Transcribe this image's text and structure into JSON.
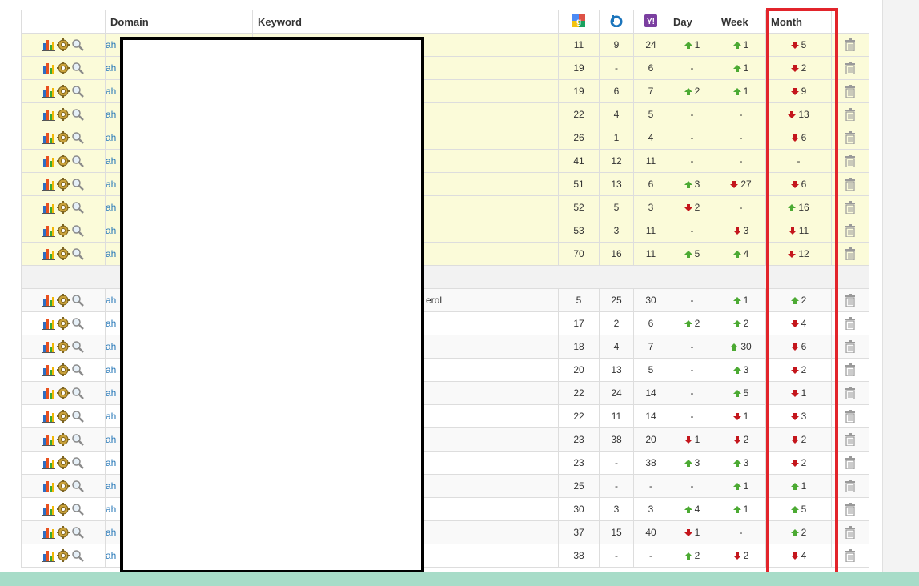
{
  "header": {
    "domain": "Domain",
    "keyword": "Keyword",
    "google_icon": "google-icon",
    "bing_icon": "bing-icon",
    "yahoo_icon": "yahoo-icon",
    "day": "Day",
    "week": "Week",
    "month": "Month"
  },
  "colors": {
    "highlight_row": "#fbfbd9",
    "up_arrow": "#4caa33",
    "down_arrow": "#c4161c",
    "link": "#2a7ab9",
    "annotation_box": "#e2242b",
    "bottom_bar": "#a7dcc8"
  },
  "icons": {
    "stats": "bar-chart-icon",
    "settings": "gear-icon",
    "search": "magnifier-icon",
    "delete": "trash-icon"
  },
  "group1": [
    {
      "domain": "ah",
      "keyword": "",
      "g": "11",
      "b": "9",
      "y": "24",
      "day": {
        "dir": "up",
        "v": "1"
      },
      "week": {
        "dir": "up",
        "v": "1"
      },
      "month": {
        "dir": "down",
        "v": "5"
      }
    },
    {
      "domain": "ah",
      "keyword": "",
      "g": "19",
      "b": "-",
      "y": "6",
      "day": {
        "dir": "none",
        "v": "-"
      },
      "week": {
        "dir": "up",
        "v": "1"
      },
      "month": {
        "dir": "down",
        "v": "2"
      }
    },
    {
      "domain": "ah",
      "keyword": "",
      "g": "19",
      "b": "6",
      "y": "7",
      "day": {
        "dir": "up",
        "v": "2"
      },
      "week": {
        "dir": "up",
        "v": "1"
      },
      "month": {
        "dir": "down",
        "v": "9"
      }
    },
    {
      "domain": "ah",
      "keyword": "",
      "g": "22",
      "b": "4",
      "y": "5",
      "day": {
        "dir": "none",
        "v": "-"
      },
      "week": {
        "dir": "none",
        "v": "-"
      },
      "month": {
        "dir": "down",
        "v": "13"
      }
    },
    {
      "domain": "ah",
      "keyword": "",
      "g": "26",
      "b": "1",
      "y": "4",
      "day": {
        "dir": "none",
        "v": "-"
      },
      "week": {
        "dir": "none",
        "v": "-"
      },
      "month": {
        "dir": "down",
        "v": "6"
      }
    },
    {
      "domain": "ah",
      "keyword": "",
      "g": "41",
      "b": "12",
      "y": "11",
      "day": {
        "dir": "none",
        "v": "-"
      },
      "week": {
        "dir": "none",
        "v": "-"
      },
      "month": {
        "dir": "none",
        "v": "-"
      }
    },
    {
      "domain": "ah",
      "keyword": "",
      "g": "51",
      "b": "13",
      "y": "6",
      "day": {
        "dir": "up",
        "v": "3"
      },
      "week": {
        "dir": "down",
        "v": "27"
      },
      "month": {
        "dir": "down",
        "v": "6"
      }
    },
    {
      "domain": "ah",
      "keyword": "",
      "g": "52",
      "b": "5",
      "y": "3",
      "day": {
        "dir": "down",
        "v": "2"
      },
      "week": {
        "dir": "none",
        "v": "-"
      },
      "month": {
        "dir": "up",
        "v": "16"
      }
    },
    {
      "domain": "ah",
      "keyword": "",
      "g": "53",
      "b": "3",
      "y": "11",
      "day": {
        "dir": "none",
        "v": "-"
      },
      "week": {
        "dir": "down",
        "v": "3"
      },
      "month": {
        "dir": "down",
        "v": "11"
      }
    },
    {
      "domain": "ah",
      "keyword": "",
      "g": "70",
      "b": "16",
      "y": "11",
      "day": {
        "dir": "up",
        "v": "5"
      },
      "week": {
        "dir": "up",
        "v": "4"
      },
      "month": {
        "dir": "down",
        "v": "12"
      }
    }
  ],
  "group2": [
    {
      "domain": "ah",
      "keyword": "erol",
      "g": "5",
      "b": "25",
      "y": "30",
      "day": {
        "dir": "none",
        "v": "-"
      },
      "week": {
        "dir": "up",
        "v": "1"
      },
      "month": {
        "dir": "up",
        "v": "2"
      }
    },
    {
      "domain": "ah",
      "keyword": "",
      "g": "17",
      "b": "2",
      "y": "6",
      "day": {
        "dir": "up",
        "v": "2"
      },
      "week": {
        "dir": "up",
        "v": "2"
      },
      "month": {
        "dir": "down",
        "v": "4"
      }
    },
    {
      "domain": "ah",
      "keyword": "",
      "g": "18",
      "b": "4",
      "y": "7",
      "day": {
        "dir": "none",
        "v": "-"
      },
      "week": {
        "dir": "up",
        "v": "30"
      },
      "month": {
        "dir": "down",
        "v": "6"
      }
    },
    {
      "domain": "ah",
      "keyword": "",
      "g": "20",
      "b": "13",
      "y": "5",
      "day": {
        "dir": "none",
        "v": "-"
      },
      "week": {
        "dir": "up",
        "v": "3"
      },
      "month": {
        "dir": "down",
        "v": "2"
      }
    },
    {
      "domain": "ah",
      "keyword": "",
      "g": "22",
      "b": "24",
      "y": "14",
      "day": {
        "dir": "none",
        "v": "-"
      },
      "week": {
        "dir": "up",
        "v": "5"
      },
      "month": {
        "dir": "down",
        "v": "1"
      }
    },
    {
      "domain": "ah",
      "keyword": "",
      "g": "22",
      "b": "11",
      "y": "14",
      "day": {
        "dir": "none",
        "v": "-"
      },
      "week": {
        "dir": "down",
        "v": "1"
      },
      "month": {
        "dir": "down",
        "v": "3"
      }
    },
    {
      "domain": "ah",
      "keyword": "",
      "g": "23",
      "b": "38",
      "y": "20",
      "day": {
        "dir": "down",
        "v": "1"
      },
      "week": {
        "dir": "down",
        "v": "2"
      },
      "month": {
        "dir": "down",
        "v": "2"
      }
    },
    {
      "domain": "ah",
      "keyword": "",
      "g": "23",
      "b": "-",
      "y": "38",
      "day": {
        "dir": "up",
        "v": "3"
      },
      "week": {
        "dir": "up",
        "v": "3"
      },
      "month": {
        "dir": "down",
        "v": "2"
      }
    },
    {
      "domain": "ah",
      "keyword": "",
      "g": "25",
      "b": "-",
      "y": "-",
      "day": {
        "dir": "none",
        "v": "-"
      },
      "week": {
        "dir": "up",
        "v": "1"
      },
      "month": {
        "dir": "up",
        "v": "1"
      }
    },
    {
      "domain": "ah",
      "keyword": "",
      "g": "30",
      "b": "3",
      "y": "3",
      "day": {
        "dir": "up",
        "v": "4"
      },
      "week": {
        "dir": "up",
        "v": "1"
      },
      "month": {
        "dir": "up",
        "v": "5"
      }
    },
    {
      "domain": "ah",
      "keyword": "",
      "g": "37",
      "b": "15",
      "y": "40",
      "day": {
        "dir": "down",
        "v": "1"
      },
      "week": {
        "dir": "none",
        "v": "-"
      },
      "month": {
        "dir": "up",
        "v": "2"
      }
    },
    {
      "domain": "ah",
      "keyword": "",
      "g": "38",
      "b": "-",
      "y": "-",
      "day": {
        "dir": "up",
        "v": "2"
      },
      "week": {
        "dir": "down",
        "v": "2"
      },
      "month": {
        "dir": "down",
        "v": "4"
      }
    }
  ]
}
